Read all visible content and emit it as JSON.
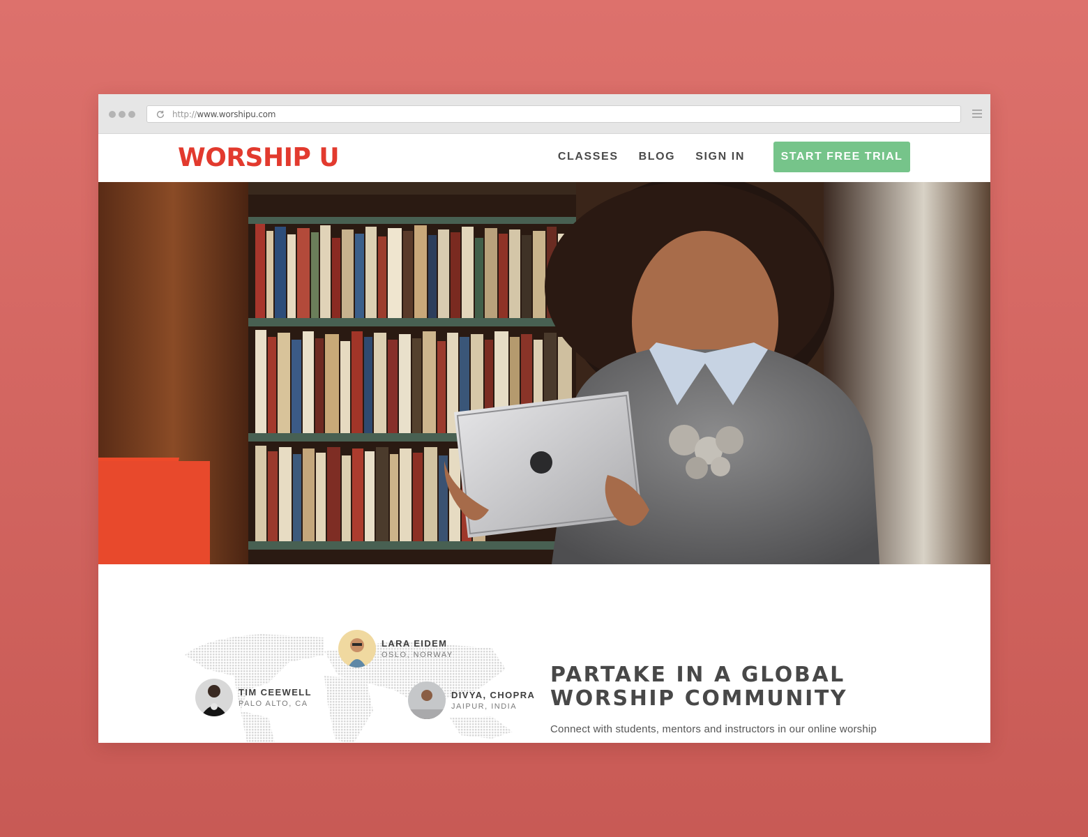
{
  "browser": {
    "url_protocol": "http://",
    "url_host": "www.worshipu.com"
  },
  "navbar": {
    "logo": "WORSHIP U",
    "links": [
      "CLASSES",
      "BLOG",
      "SIGN IN"
    ],
    "cta_label": "START FREE TRIAL"
  },
  "colors": {
    "brand": "#e23a2e",
    "cta": "#76c48a",
    "background": "#d9685f"
  },
  "community": {
    "people": [
      {
        "name": "LARA EIDEM",
        "location": "OSLO, NORWAY"
      },
      {
        "name": "TIM CEEWELL",
        "location": "PALO ALTO, CA"
      },
      {
        "name": "DIVYA, CHOPRA",
        "location": "JAIPUR, INDIA"
      }
    ],
    "heading_line1": "PARTAKE IN A GLOBAL",
    "heading_line2": "WORSHIP COMMUNITY",
    "body": "Connect with students, mentors and instructors in our online worship"
  }
}
